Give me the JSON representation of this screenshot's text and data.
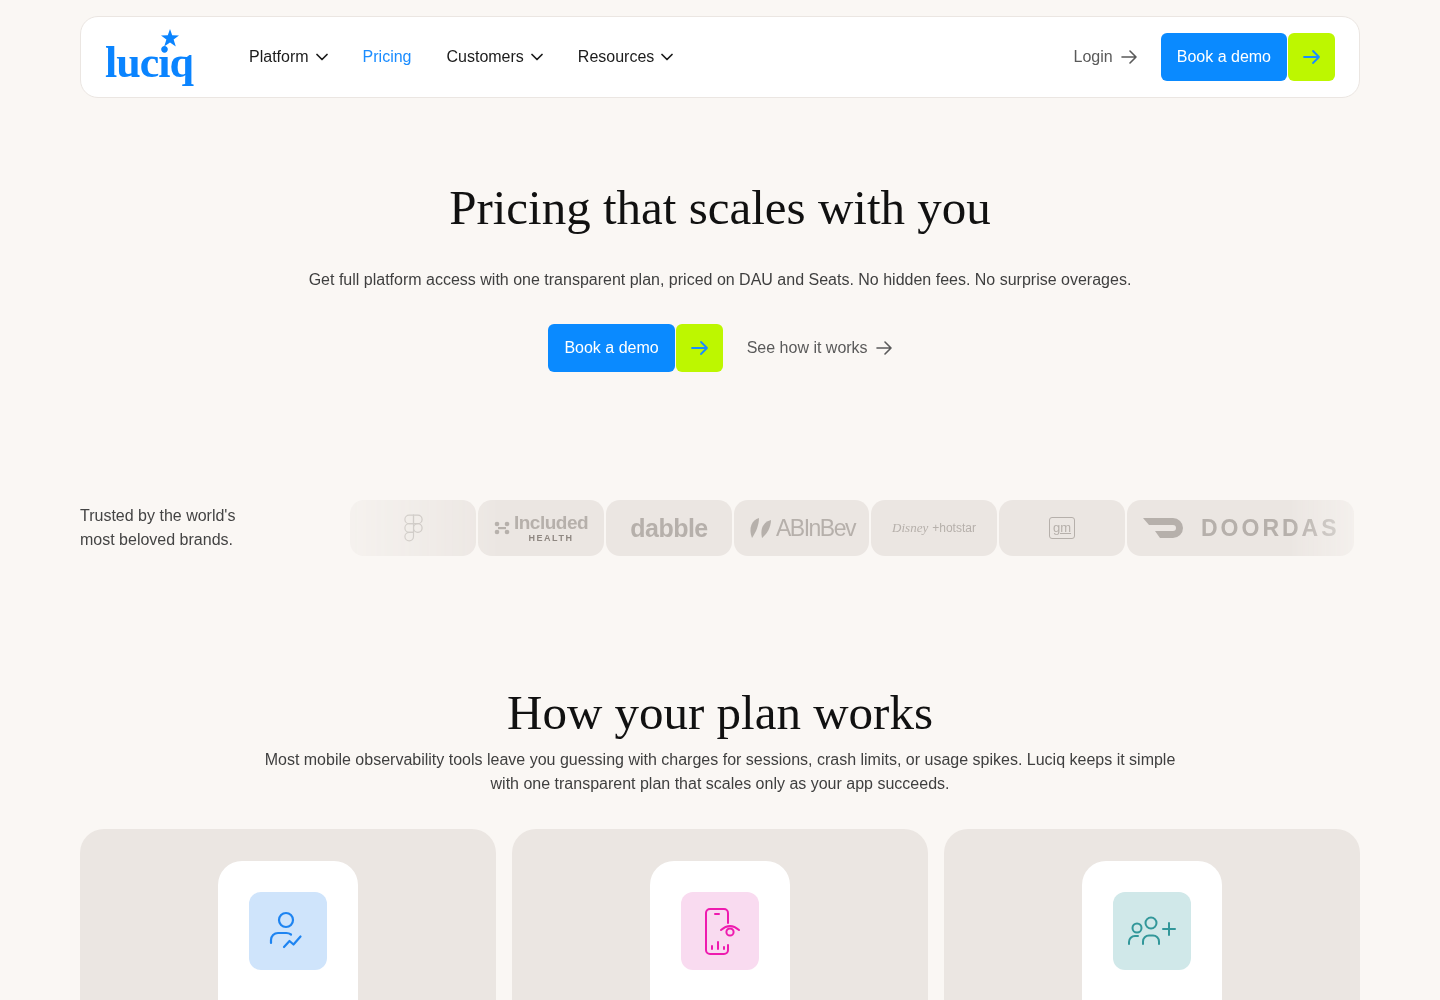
{
  "nav": {
    "logo": "luciq",
    "items": [
      {
        "label": "Platform",
        "dropdown": true,
        "selected": false
      },
      {
        "label": "Pricing",
        "dropdown": false,
        "selected": true
      },
      {
        "label": "Customers",
        "dropdown": true,
        "selected": false
      },
      {
        "label": "Resources",
        "dropdown": true,
        "selected": false
      }
    ],
    "login": "Login",
    "cta": "Book a demo"
  },
  "hero": {
    "title": "Pricing that scales with you",
    "subtitle": "Get full platform access with one transparent plan, priced on DAU and Seats. No hidden fees. No surprise overages.",
    "cta": "Book a demo",
    "link": "See how it works"
  },
  "brands": {
    "caption": "Trusted by the world's most beloved brands.",
    "logos": [
      {
        "kind": "shapes"
      },
      {
        "kind": "dots-wordmark",
        "name": "Included",
        "tagline": "HEALTH"
      },
      {
        "kind": "wordmark",
        "name": "dabble"
      },
      {
        "kind": "leaf-wordmark",
        "name": "ABInBev"
      },
      {
        "kind": "script-wordmark",
        "name": "Disney",
        "tagline": "+hotstar"
      },
      {
        "kind": "boxed",
        "name": "gm"
      },
      {
        "kind": "swoosh-wordmark",
        "name": "DOORDAS"
      }
    ]
  },
  "plan": {
    "title": "How your plan works",
    "text": "Most mobile observability tools leave you guessing with charges for sessions, crash limits, or usage spikes. Luciq keeps it simple with one transparent plan that scales only as your app succeeds.",
    "cards": [
      {
        "kind": "user-growth",
        "color": "#cfe4fb"
      },
      {
        "kind": "phone-insight",
        "color": "#f9dbf0"
      },
      {
        "kind": "team-add",
        "color": "#d0e8e9"
      }
    ]
  }
}
